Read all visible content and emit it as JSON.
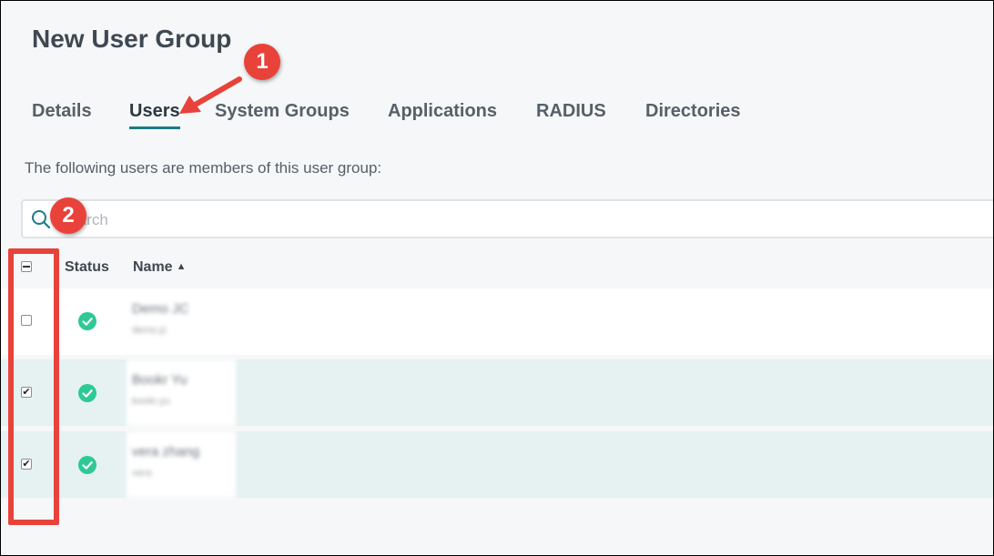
{
  "page": {
    "title": "New User Group"
  },
  "tabs": [
    {
      "label": "Details"
    },
    {
      "label": "Users"
    },
    {
      "label": "System Groups"
    },
    {
      "label": "Applications"
    },
    {
      "label": "RADIUS"
    },
    {
      "label": "Directories"
    }
  ],
  "active_tab": "Users",
  "intro_text": "The following users are members of this user group:",
  "search": {
    "placeholder": "Search",
    "value": ""
  },
  "table": {
    "columns": [
      {
        "label": "Status"
      },
      {
        "label": "Name",
        "sort": "ascending"
      }
    ],
    "select_all_state": "indeterminate",
    "rows": [
      {
        "name": "Demo JC",
        "sub": "demo.jc",
        "selected": false,
        "status": "active"
      },
      {
        "name": "Bookr Yu",
        "sub": "bookr.yu",
        "selected": true,
        "status": "active"
      },
      {
        "name": "vera zhang",
        "sub": "vera",
        "selected": true,
        "status": "active"
      }
    ]
  },
  "annotations": [
    {
      "label": "1"
    },
    {
      "label": "2"
    }
  ],
  "colors": {
    "accent": "#1a7b86",
    "annotation": "#e8423b",
    "status_ok": "#2ec995",
    "selected_row": "#e6f1f1"
  },
  "icons": {
    "search": "search-icon",
    "status": "check-circle-icon",
    "sort": "caret-up-icon"
  }
}
